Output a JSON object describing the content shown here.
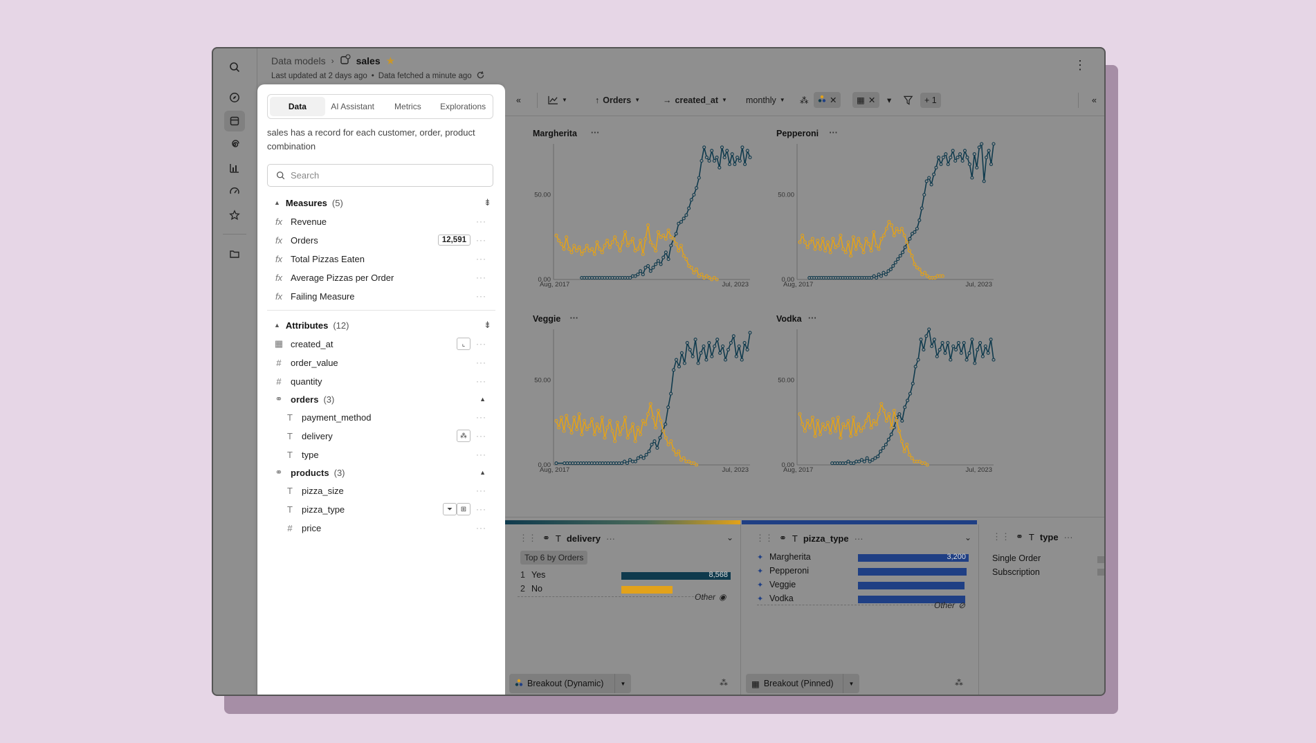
{
  "header": {
    "breadcrumb_root": "Data models",
    "title": "sales",
    "last_updated": "Last updated at 2 days ago",
    "separator": "•",
    "data_fetched": "Data fetched a minute ago"
  },
  "panel": {
    "tabs": [
      "Data",
      "AI Assistant",
      "Metrics",
      "Explorations"
    ],
    "description": "sales has a record for each customer, order, product combination",
    "search_placeholder": "Search",
    "measures_title": "Measures",
    "measures_count": "(5)",
    "measures": [
      {
        "label": "Revenue"
      },
      {
        "label": "Orders",
        "badge": "12,591"
      },
      {
        "label": "Total Pizzas Eaten"
      },
      {
        "label": "Average Pizzas per Order"
      },
      {
        "label": "Failing Measure"
      }
    ],
    "attributes_title": "Attributes",
    "attributes_count": "(12)",
    "attributes": [
      "created_at",
      "order_value",
      "quantity"
    ],
    "orders_title": "orders",
    "orders_count": "(3)",
    "orders_items": [
      "payment_method",
      "delivery",
      "type"
    ],
    "products_title": "products",
    "products_count": "(3)",
    "products_items": [
      "pizza_size",
      "pizza_type",
      "price"
    ]
  },
  "toolbar": {
    "measure": "Orders",
    "dimension": "created_at",
    "granularity": "monthly",
    "filter_extra": "+ 1"
  },
  "charts": [
    {
      "title": "Margherita"
    },
    {
      "title": "Pepperoni"
    },
    {
      "title": "Veggie"
    },
    {
      "title": "Vodka"
    }
  ],
  "axis": {
    "y_mid": "50.00",
    "y_zero": "0.00",
    "x_start": "Aug, 2017",
    "x_end": "Jul, 2023"
  },
  "chart_data": {
    "type": "line",
    "small_multiples_by": "pizza_type",
    "x_range": [
      "Aug, 2017",
      "Jul, 2023"
    ],
    "ylim": [
      0,
      80
    ],
    "series_colors": {
      "Yes": "#0f3a4d",
      "No": "#e3a21a"
    },
    "panels": [
      {
        "title": "Margherita",
        "series": [
          {
            "name": "Yes",
            "values": [
              null,
              null,
              null,
              null,
              null,
              null,
              null,
              null,
              null,
              null,
              1,
              1,
              1,
              1,
              1,
              1,
              1,
              1,
              1,
              1,
              1,
              1,
              1,
              1,
              1,
              1,
              1,
              1,
              1,
              1,
              2,
              2,
              3,
              5,
              3,
              7,
              8,
              5,
              7,
              9,
              11,
              9,
              13,
              16,
              12,
              20,
              24,
              27,
              33,
              34,
              36,
              38,
              42,
              47,
              50,
              54,
              60,
              70,
              78,
              72,
              70,
              76,
              70,
              72,
              66,
              78,
              72,
              76,
              68,
              74,
              68,
              72,
              70,
              78,
              68,
              76,
              72
            ]
          },
          {
            "name": "No",
            "values": [
              26,
              23,
              21,
              18,
              25,
              18,
              16,
              20,
              17,
              19,
              15,
              17,
              20,
              17,
              18,
              15,
              22,
              18,
              16,
              20,
              23,
              19,
              22,
              25,
              21,
              17,
              22,
              28,
              20,
              22,
              24,
              17,
              18,
              23,
              15,
              24,
              32,
              22,
              20,
              17,
              28,
              25,
              26,
              24,
              29,
              25,
              24,
              21,
              17,
              20,
              14,
              12,
              8,
              7,
              4,
              6,
              2,
              3,
              1,
              2,
              1,
              0,
              1,
              0
            ]
          }
        ]
      },
      {
        "title": "Pepperoni",
        "series": [
          {
            "name": "Yes",
            "values": [
              null,
              null,
              null,
              null,
              1,
              1,
              1,
              1,
              1,
              1,
              1,
              1,
              1,
              1,
              1,
              1,
              1,
              1,
              1,
              1,
              1,
              1,
              1,
              1,
              1,
              1,
              1,
              1,
              1,
              1,
              1,
              2,
              1,
              3,
              2,
              4,
              3,
              5,
              6,
              8,
              10,
              12,
              14,
              16,
              19,
              22,
              24,
              27,
              28,
              30,
              35,
              42,
              50,
              58,
              60,
              56,
              62,
              66,
              72,
              68,
              72,
              74,
              68,
              72,
              76,
              70,
              72,
              74,
              70,
              76,
              72,
              68,
              60,
              74,
              66,
              78,
              80,
              58,
              72,
              76,
              68,
              80
            ]
          },
          {
            "name": "No",
            "values": [
              22,
              26,
              22,
              19,
              22,
              24,
              18,
              23,
              18,
              24,
              17,
              22,
              16,
              24,
              19,
              20,
              26,
              18,
              16,
              22,
              14,
              25,
              18,
              24,
              20,
              16,
              24,
              21,
              17,
              28,
              20,
              18,
              24,
              26,
              30,
              34,
              32,
              26,
              30,
              28,
              30,
              26,
              22,
              17,
              14,
              9,
              7,
              6,
              3,
              4,
              2,
              1,
              1,
              1,
              2,
              2,
              2
            ]
          }
        ]
      },
      {
        "title": "Veggie",
        "series": [
          {
            "name": "Yes",
            "values": [
              1,
              null,
              null,
              1,
              1,
              1,
              1,
              1,
              1,
              1,
              1,
              1,
              1,
              1,
              1,
              1,
              1,
              1,
              1,
              1,
              1,
              1,
              1,
              1,
              1,
              2,
              1,
              3,
              2,
              2,
              4,
              5,
              4,
              6,
              8,
              12,
              14,
              10,
              16,
              20,
              24,
              34,
              42,
              56,
              62,
              58,
              66,
              60,
              72,
              68,
              64,
              74,
              60,
              66,
              70,
              62,
              72,
              64,
              70,
              74,
              66,
              70,
              62,
              68,
              72,
              76,
              64,
              70,
              62,
              72,
              68,
              78
            ]
          },
          {
            "name": "No",
            "values": [
              26,
              22,
              28,
              20,
              29,
              23,
              19,
              28,
              21,
              30,
              18,
              26,
              21,
              23,
              27,
              18,
              24,
              20,
              28,
              16,
              22,
              26,
              20,
              14,
              25,
              18,
              22,
              28,
              16,
              20,
              24,
              14,
              22,
              18,
              26,
              24,
              30,
              36,
              28,
              22,
              32,
              26,
              20,
              16,
              12,
              14,
              9,
              6,
              8,
              3,
              4,
              2,
              2,
              1,
              1,
              0
            ]
          }
        ]
      },
      {
        "title": "Vodka",
        "series": [
          {
            "name": "Yes",
            "values": [
              null,
              null,
              null,
              null,
              null,
              null,
              null,
              null,
              null,
              null,
              null,
              null,
              1,
              1,
              1,
              1,
              1,
              1,
              2,
              1,
              1,
              2,
              2,
              3,
              2,
              4,
              2,
              3,
              4,
              5,
              8,
              10,
              12,
              15,
              18,
              22,
              28,
              30,
              26,
              34,
              38,
              42,
              48,
              58,
              62,
              74,
              68,
              76,
              80,
              70,
              74,
              64,
              68,
              72,
              66,
              72,
              62,
              70,
              68,
              72,
              66,
              72,
              62,
              66,
              74,
              60,
              68,
              72,
              64,
              70,
              66,
              74,
              62
            ]
          },
          {
            "name": "No",
            "values": [
              30,
              24,
              20,
              26,
              22,
              28,
              17,
              26,
              18,
              24,
              21,
              25,
              19,
              27,
              20,
              28,
              16,
              24,
              22,
              26,
              17,
              28,
              18,
              24,
              20,
              22,
              26,
              30,
              22,
              26,
              24,
              30,
              36,
              32,
              26,
              30,
              22,
              32,
              26,
              20,
              14,
              8,
              12,
              6,
              4,
              2,
              2,
              2,
              1,
              1,
              0
            ]
          }
        ]
      }
    ]
  },
  "breakouts": {
    "delivery": {
      "title": "delivery",
      "subtitle": "Top 6 by Orders",
      "items": [
        {
          "rank": "1",
          "label": "Yes",
          "value": "8,568",
          "fraction": 1.0,
          "color": "#0f3a4d"
        },
        {
          "rank": "2",
          "label": "No",
          "value": "",
          "fraction": 0.47,
          "color": "#e3a21a"
        }
      ],
      "other_label": "Other",
      "footer": "Breakout (Dynamic)"
    },
    "pizza_type": {
      "title": "pizza_type",
      "items": [
        {
          "label": "Margherita",
          "value": "3,200",
          "fraction": 1.0
        },
        {
          "label": "Pepperoni",
          "value": "",
          "fraction": 0.98
        },
        {
          "label": "Veggie",
          "value": "",
          "fraction": 0.96
        },
        {
          "label": "Vodka",
          "value": "",
          "fraction": 0.97
        }
      ],
      "color": "#1f3f84",
      "other_label": "Other",
      "footer": "Breakout (Pinned)"
    },
    "type": {
      "title": "type",
      "items": [
        "Single Order",
        "Subscription"
      ]
    }
  }
}
